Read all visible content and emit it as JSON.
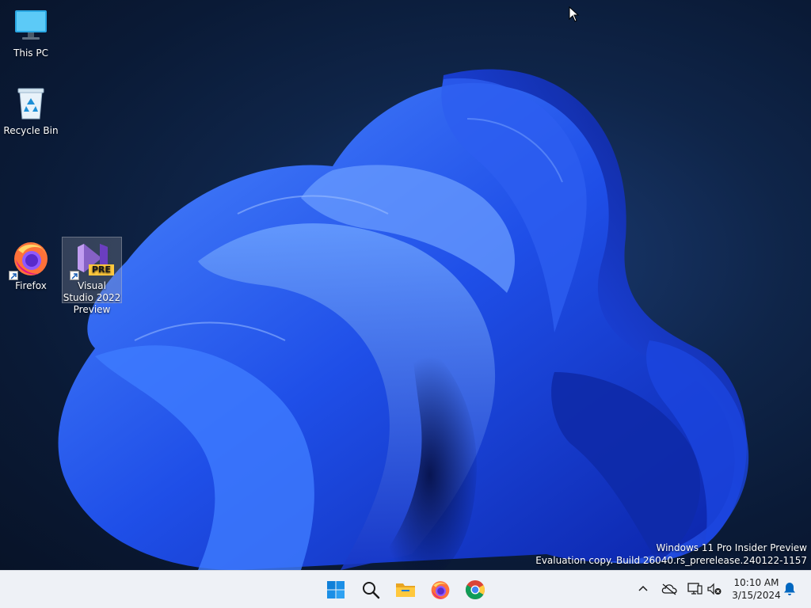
{
  "desktop": {
    "icons": [
      {
        "label": "This PC",
        "icon": "computer-icon"
      },
      {
        "label": "Recycle Bin",
        "icon": "recycle-bin-icon"
      },
      {
        "label": "Firefox",
        "icon": "firefox-icon"
      },
      {
        "label": "Visual Studio 2022 Preview",
        "icon": "visual-studio-preview-icon",
        "badge": "PRE",
        "selected": true
      }
    ],
    "watermark": {
      "line1": "Windows 11 Pro Insider Preview",
      "line2": "Evaluation copy. Build 26040.rs_prerelease.240122-1157"
    }
  },
  "taskbar": {
    "apps": [
      {
        "name": "Start",
        "icon": "windows-start-icon"
      },
      {
        "name": "Search",
        "icon": "search-icon"
      },
      {
        "name": "File Explorer",
        "icon": "folder-icon"
      },
      {
        "name": "Firefox",
        "icon": "firefox-icon"
      },
      {
        "name": "Chrome",
        "icon": "chrome-icon"
      }
    ],
    "tray": {
      "icons": [
        "chevron-up-icon",
        "onedrive-icon",
        "network-icon",
        "volume-muted-icon"
      ],
      "time": "10:10 AM",
      "date": "3/15/2024",
      "notification_icon": "bell-icon"
    }
  },
  "colors": {
    "accent": "#0067c0",
    "wallpaper_bloom": "#2f6bff",
    "taskbar_bg": "#eef1f6"
  }
}
